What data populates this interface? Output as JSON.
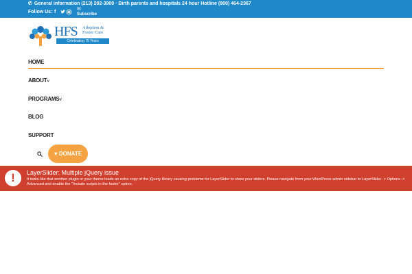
{
  "topbar": {
    "info_text": "General information (213) 202-3900 · Birth parents and hospitals 24 hour Hotline (800) 464-2367",
    "follow_label": "Follow Us:",
    "social_facebook": "f",
    "social_twitter": "🐦",
    "social_instagram": "◎",
    "mail_icon": "✉",
    "subscribe_label": "Subscribe"
  },
  "logo": {
    "main": "HFS",
    "line1": "Adoption &",
    "line2": "Foster Care",
    "ribbon": "Celebrating 75 Years"
  },
  "nav": {
    "home": "HOME",
    "about": "ABOUT",
    "programs": "PROGRAMS",
    "blog": "BLOG",
    "support": "SUPPORT",
    "caret": "˅",
    "donate_label": "DONATE",
    "heart": "♥"
  },
  "alert": {
    "icon": "!",
    "title": "LayerSlider: Multiple jQuery issue",
    "body": "It looks like that another plugin or your theme loads an extra copy of the jQuery library causing problems for LayerSlider to show your sliders. Please navigate from your WordPress admin sidebar to LayerSlider -> Options -> Advanced and enable the \"Include scripts in the footer\" option."
  },
  "colors": {
    "topbar": "#1e88c9",
    "accent_orange": "#f5a242",
    "alert_red": "#d0402f",
    "logo_blue": "#1e6fb5"
  }
}
